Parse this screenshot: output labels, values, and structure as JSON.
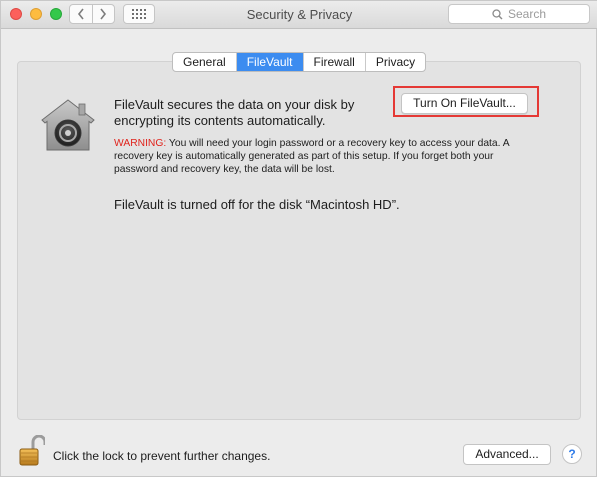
{
  "window": {
    "title": "Security & Privacy",
    "search_placeholder": "Search"
  },
  "tabs": [
    {
      "label": "General",
      "active": false
    },
    {
      "label": "FileVault",
      "active": true
    },
    {
      "label": "Firewall",
      "active": false
    },
    {
      "label": "Privacy",
      "active": false
    }
  ],
  "filevault": {
    "description": "FileVault secures the data on your disk by encrypting its contents automatically.",
    "turn_on_label": "Turn On FileVault...",
    "warning_label": "WARNING:",
    "warning_text": " You will need your login password or a recovery key to access your data. A recovery key is automatically generated as part of this setup. If you forget both your password and recovery key, the data will be lost.",
    "status": "FileVault is turned off for the disk “Macintosh HD”."
  },
  "footer": {
    "lock_text": "Click the lock to prevent further changes.",
    "advanced_label": "Advanced...",
    "help_label": "?"
  },
  "icons": {
    "back": "chevron-left-icon",
    "forward": "chevron-right-icon",
    "show_all": "grid-icon",
    "search": "search-icon",
    "filevault": "filevault-house-icon",
    "lock": "padlock-icon"
  },
  "colors": {
    "active_tab": "#3c8cf0",
    "warning": "#e0231c",
    "highlight": "#e53935"
  }
}
